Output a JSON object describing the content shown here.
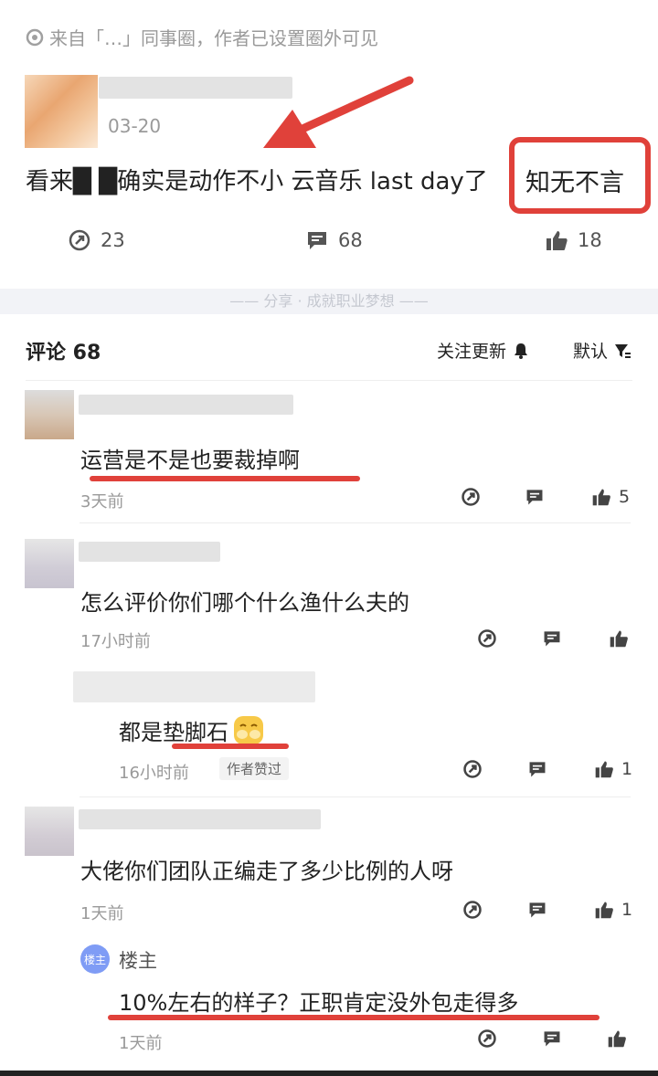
{
  "source_line": "来自「…」同事圈，作者已设置圈外可见",
  "post": {
    "date": "03-20",
    "text": "看来█ █确实是动作不小 云音乐 last day了",
    "highlight": "知无不言",
    "share_count": "23",
    "comment_count": "68",
    "like_count": "18"
  },
  "divider_text": "—— 分享 · 成就职业梦想 ——",
  "comments_header": {
    "title": "评论 68",
    "follow_label": "关注更新",
    "sort_label": "默认"
  },
  "comments": [
    {
      "text": "运营是不是也要裁掉啊",
      "time": "3天前",
      "likes": "5"
    },
    {
      "text": "怎么评价你们哪个什么渔什么夫的",
      "time": "17小时前",
      "likes": ""
    },
    {
      "text": "都是垫脚石",
      "time": "16小时前",
      "tag": "作者赞过",
      "likes": "1"
    },
    {
      "text": "大佬你们团队正编走了多少比例的人呀",
      "time": "1天前",
      "likes": "1"
    },
    {
      "badge": "楼主",
      "author": "楼主",
      "text": "10%左右的样子？正职肯定没外包走得多",
      "time": "1天前",
      "likes": ""
    }
  ],
  "colors": {
    "accent_red": "#e0413a",
    "badge_blue": "#7f9cf5"
  }
}
